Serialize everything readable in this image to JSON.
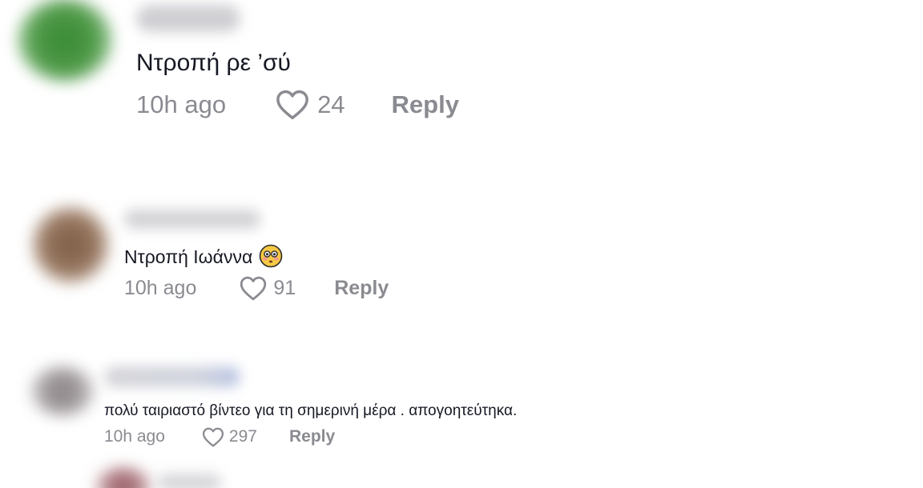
{
  "colors": {
    "text": "#161823",
    "muted": "#8a8b91",
    "avatar_1": "#3f8c3a",
    "avatar_2": "#8a6a52",
    "avatar_3": "#8f8a8c",
    "avatar_4": "#9e6a72",
    "username_blur": "#c9c9ce",
    "username_blur_3": "#b9c2dc"
  },
  "comments": [
    {
      "text": "Ντροπή ρε ’σύ",
      "time": "10h ago",
      "likes": "24",
      "reply_label": "Reply",
      "like_icon": "heart-outline-icon"
    },
    {
      "text": "Ντροπή Ιωάννα",
      "emoji": "flushed-face-emoji",
      "time": "10h ago",
      "likes": "91",
      "reply_label": "Reply",
      "like_icon": "heart-outline-icon"
    },
    {
      "text": "πολύ ταιριαστό βίντεο για τη σημερινή μέρα . απογοητεύτηκα.",
      "time": "10h ago",
      "likes": "297",
      "reply_label": "Reply",
      "like_icon": "heart-outline-icon"
    }
  ]
}
